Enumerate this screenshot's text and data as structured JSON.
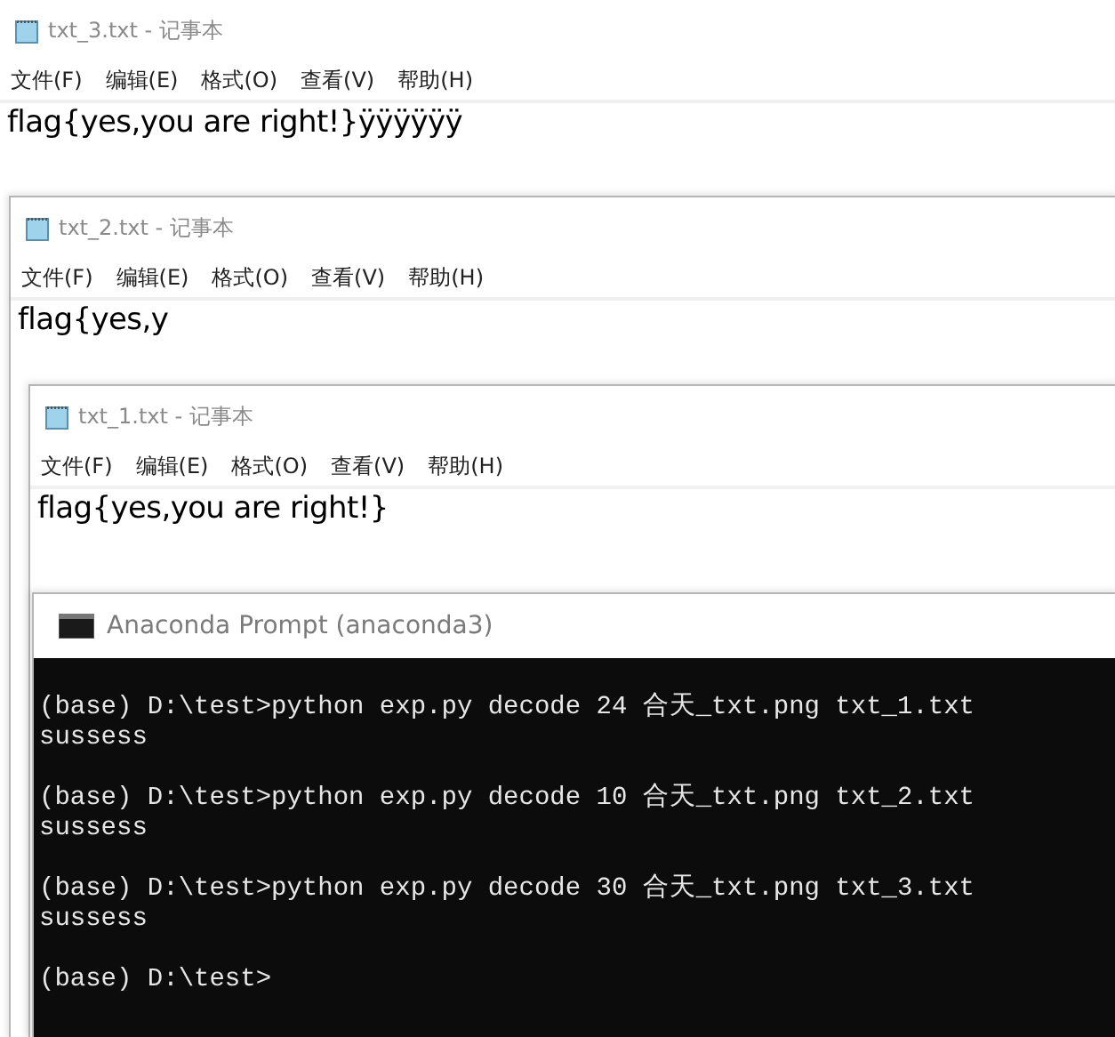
{
  "windows": [
    {
      "kind": "notepad",
      "title": "txt_3.txt - 记事本",
      "menu": [
        "文件(F)",
        "编辑(E)",
        "格式(O)",
        "查看(V)",
        "帮助(H)"
      ],
      "text": "flag{yes,you are right!}ÿÿÿÿÿÿ"
    },
    {
      "kind": "notepad",
      "title": "txt_2.txt - 记事本",
      "menu": [
        "文件(F)",
        "编辑(E)",
        "格式(O)",
        "查看(V)",
        "帮助(H)"
      ],
      "text": "flag{yes,y"
    },
    {
      "kind": "notepad",
      "title": "txt_1.txt - 记事本",
      "menu": [
        "文件(F)",
        "编辑(E)",
        "格式(O)",
        "查看(V)",
        "帮助(H)"
      ],
      "text": "flag{yes,you are right!}"
    },
    {
      "kind": "console",
      "title": "Anaconda Prompt (anaconda3)",
      "blocks": [
        {
          "lines": [
            "(base) D:\\test>python exp.py decode 24 合天_txt.png txt_1.txt",
            "sussess"
          ]
        },
        {
          "lines": [
            "(base) D:\\test>python exp.py decode 10 合天_txt.png txt_2.txt",
            "sussess"
          ]
        },
        {
          "lines": [
            "(base) D:\\test>python exp.py decode 30 合天_txt.png txt_3.txt",
            "sussess"
          ]
        },
        {
          "lines": [
            "(base) D:\\test>"
          ]
        }
      ]
    }
  ]
}
